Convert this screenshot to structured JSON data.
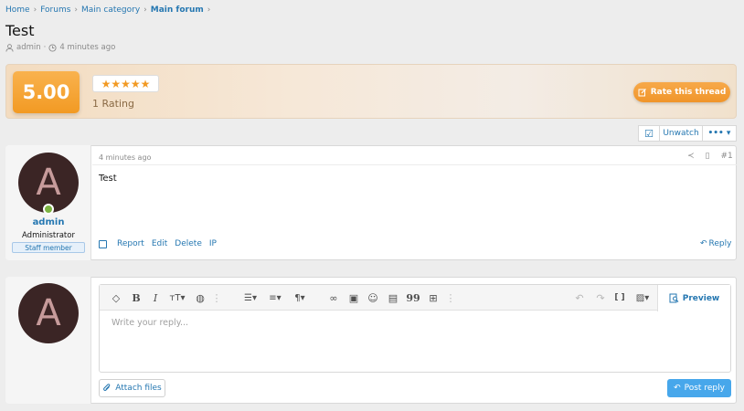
{
  "breadcrumb": {
    "items": [
      "Home",
      "Forums",
      "Main category"
    ],
    "current": "Main forum",
    "separator": "›"
  },
  "thread": {
    "title": "Test",
    "author": "admin",
    "time": "4 minutes ago",
    "meta_separator": "·"
  },
  "rating": {
    "score": "5.00",
    "stars": "★★★★★",
    "count_label": "1 Rating",
    "rate_button": "Rate this thread"
  },
  "watch_bar": {
    "check_icon": "☑",
    "unwatch_label": "Unwatch",
    "more_label": "••• ▾"
  },
  "post": {
    "avatar_letter": "A",
    "username": "admin",
    "user_title": "Administrator",
    "banner": "Staff member",
    "date": "4 minutes ago",
    "number": "#1",
    "share_icon": "≺",
    "bookmark_icon": "▯",
    "body": "Test",
    "actions": [
      "Report",
      "Edit",
      "Delete",
      "IP"
    ],
    "reply_label": "Reply",
    "reply_icon": "↶"
  },
  "quick_reply": {
    "avatar_letter": "A",
    "placeholder": "Write your reply...",
    "preview_label": "Preview",
    "preview_icon": "🔍︎",
    "attach_label": "Attach files",
    "attach_icon": "⌀",
    "submit_label": "Post reply",
    "submit_icon": "↶",
    "toolbar": {
      "eraser": "◇",
      "bold": "B",
      "italic": "I",
      "size": "тT▾",
      "color": "◍",
      "more1": "⋮",
      "list": "☰▾",
      "align": "≡▾",
      "paragraph": "¶▾",
      "link": "∞",
      "image": "▣",
      "emoji": "☺",
      "media": "▤",
      "quote": "99",
      "table": "⊞",
      "more2": "⋮",
      "undo": "↶",
      "redo": "↷",
      "code": "[ ]",
      "drafts": "▨▾"
    }
  },
  "colors": {
    "link": "#2577b1",
    "accent_orange": "#f29a23",
    "button_blue": "#47a7eb",
    "avatar_bg": "#3b2525",
    "online_green": "#7cb342"
  }
}
